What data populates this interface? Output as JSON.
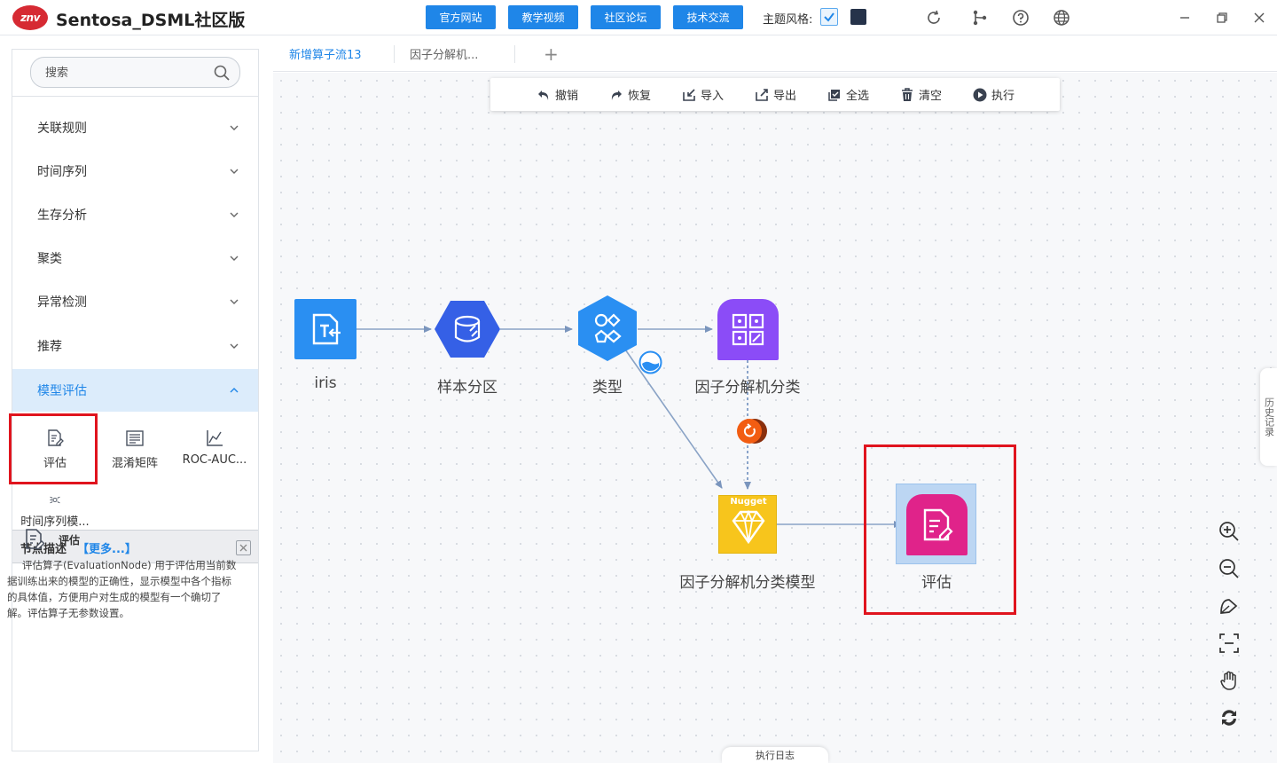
{
  "app": {
    "logo_text": "znv",
    "title": "Sentosa_DSML社区版"
  },
  "top_buttons": [
    "官方网站",
    "教学视频",
    "社区论坛",
    "技术交流"
  ],
  "theme": {
    "label": "主题风格:",
    "light_checked": true,
    "accent": "#1f86e8"
  },
  "search": {
    "placeholder": "搜索"
  },
  "categories": [
    {
      "label": "关联规则",
      "expanded": false
    },
    {
      "label": "时间序列",
      "expanded": false
    },
    {
      "label": "生存分析",
      "expanded": false
    },
    {
      "label": "聚类",
      "expanded": false
    },
    {
      "label": "异常检测",
      "expanded": false
    },
    {
      "label": "推荐",
      "expanded": false
    },
    {
      "label": "模型评估",
      "expanded": true
    }
  ],
  "sub_items": [
    {
      "label": "评估",
      "icon": "evaluate-icon"
    },
    {
      "label": "混淆矩阵",
      "icon": "confusion-matrix-icon"
    },
    {
      "label": "ROC-AUC...",
      "icon": "roc-auc-icon"
    },
    {
      "label": "时间序列模...",
      "icon": "time-series-model-icon"
    }
  ],
  "description": {
    "title": "节点描述",
    "more": "【更多...】",
    "node_name": "评估",
    "text": "评估算子(EvaluationNode) 用于评估用当前数据训练出来的模型的正确性，显示模型中各个指标的具体值，方便用户对生成的模型有一个确切了解。评估算子无参数设置。"
  },
  "tabs": [
    {
      "label": "新增算子流13",
      "active": true
    },
    {
      "label": "因子分解机...",
      "active": false
    }
  ],
  "toolbar": {
    "undo": "撤销",
    "redo": "恢复",
    "import": "导入",
    "export": "导出",
    "select_all": "全选",
    "clear": "清空",
    "run": "执行"
  },
  "nodes": {
    "iris": "iris",
    "sample_partition": "样本分区",
    "type": "类型",
    "fm_classifier": "因子分解机分类",
    "fm_model": "因子分解机分类模型",
    "nugget_badge": "Nugget",
    "evaluate": "评估"
  },
  "side_tabs": {
    "history": "历史记录",
    "log": "执行日志"
  }
}
